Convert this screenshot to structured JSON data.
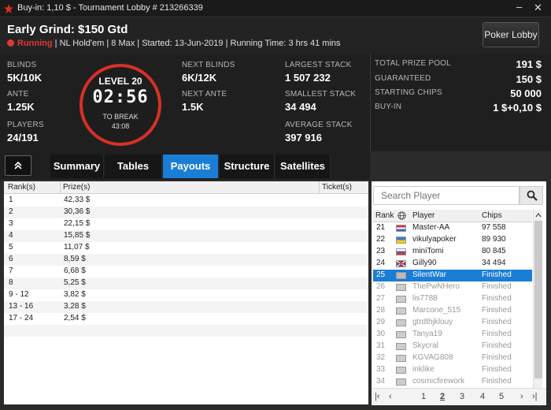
{
  "window": {
    "title": "Buy-in: 1,10 $ - Tournament Lobby # 213266339",
    "minimize": "–",
    "close": "✕"
  },
  "header": {
    "name": "Early Grind: $150 Gtd",
    "status": "Running",
    "details": "| NL Hold'em | 8 Max | Started: 13-Jun-2019 | Running Time: 3 hrs  41 mins",
    "lobby_button": "Poker Lobby"
  },
  "info": {
    "blinds_label": "BLINDS",
    "blinds": "5K/10K",
    "ante_label": "ANTE",
    "ante": "1.25K",
    "players_label": "PLAYERS",
    "players": "24/191",
    "level": "LEVEL 20",
    "clock": "02:56",
    "to_break_label": "TO BREAK",
    "to_break": "43:08",
    "next_blinds_label": "NEXT BLINDS",
    "next_blinds": "6K/12K",
    "next_ante_label": "NEXT ANTE",
    "next_ante": "1.5K",
    "largest_label": "LARGEST STACK",
    "largest": "1 507 232",
    "smallest_label": "SMALLEST STACK",
    "smallest": "34 494",
    "average_label": "AVERAGE STACK",
    "average": "397 916"
  },
  "prize": {
    "pool_label": "TOTAL PRIZE POOL",
    "pool": "191 $",
    "guaranteed_label": "GUARANTEED",
    "guaranteed": "150 $",
    "chips_label": "STARTING CHIPS",
    "chips": "50 000",
    "buyin_label": "BUY-IN",
    "buyin": "1 $+0,10 $"
  },
  "collapse_icon": "chevron-up-icon",
  "tabs": [
    "Summary",
    "Tables",
    "Payouts",
    "Structure",
    "Satellites"
  ],
  "payouts": {
    "headers": {
      "rank": "Rank(s)",
      "prize": "Prize(s)",
      "ticket": "Ticket(s)"
    },
    "rows": [
      {
        "rank": "1",
        "prize": "42,33 $"
      },
      {
        "rank": "2",
        "prize": "30,36 $"
      },
      {
        "rank": "3",
        "prize": "22,15 $"
      },
      {
        "rank": "4",
        "prize": "15,85 $"
      },
      {
        "rank": "5",
        "prize": "11,07 $"
      },
      {
        "rank": "6",
        "prize": "8,59 $"
      },
      {
        "rank": "7",
        "prize": "6,68 $"
      },
      {
        "rank": "8",
        "prize": "5,25 $"
      },
      {
        "rank": "9 - 12",
        "prize": "3,82 $"
      },
      {
        "rank": "13 - 16",
        "prize": "3,28 $"
      },
      {
        "rank": "17 - 24",
        "prize": "2,54 $"
      }
    ]
  },
  "players": {
    "search_placeholder": "Search Player",
    "headers": {
      "rank": "Rank",
      "player": "Player",
      "chips": "Chips"
    },
    "rows": [
      {
        "rank": "21",
        "name": "Master-AA",
        "chips": "97 558"
      },
      {
        "rank": "22",
        "name": "vikulyapoker",
        "chips": "89 930"
      },
      {
        "rank": "23",
        "name": "miniTomi",
        "chips": "80 845"
      },
      {
        "rank": "24",
        "name": "Gilly90",
        "chips": "34 494"
      },
      {
        "rank": "25",
        "name": "SilentWar",
        "chips": "Finished"
      },
      {
        "rank": "26",
        "name": "ThePwNHero",
        "chips": "Finished"
      },
      {
        "rank": "27",
        "name": "lis7788",
        "chips": "Finished"
      },
      {
        "rank": "28",
        "name": "Marcone_515",
        "chips": "Finished"
      },
      {
        "rank": "29",
        "name": "gtrdthjklouy",
        "chips": "Finished"
      },
      {
        "rank": "30",
        "name": "Tanya19",
        "chips": "Finished"
      },
      {
        "rank": "31",
        "name": "Skycral",
        "chips": "Finished"
      },
      {
        "rank": "32",
        "name": "KGVAG808",
        "chips": "Finished"
      },
      {
        "rank": "33",
        "name": "inklike",
        "chips": "Finished"
      },
      {
        "rank": "34",
        "name": "cosmicfirework",
        "chips": "Finished"
      }
    ],
    "pages": [
      "1",
      "2",
      "3",
      "4",
      "5"
    ],
    "current_page": "2"
  },
  "colors": {
    "accent": "#1a7ed6",
    "running": "#e03a2e",
    "clock_ring": "#d83025"
  }
}
